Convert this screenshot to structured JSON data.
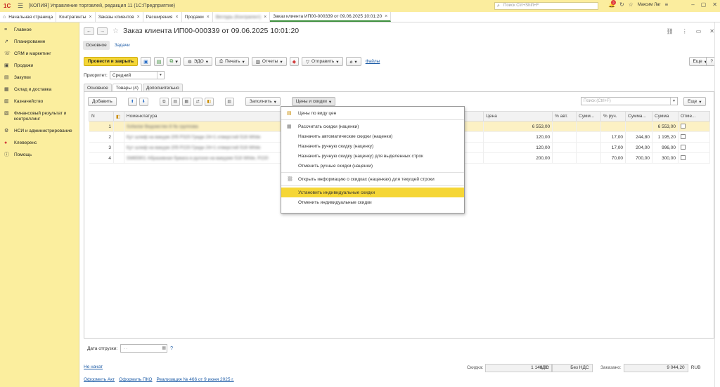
{
  "titlebar": {
    "logo": "1С",
    "title": "[КОПИЯ] Управление торговлей, редакция 11  (1С:Предприятие)",
    "search_placeholder": "Поиск Ctrl+Shift+F",
    "notification_count": "2",
    "user": "Максим Лаг"
  },
  "tabs": [
    {
      "label": "Начальная страница"
    },
    {
      "label": "Контрагенты"
    },
    {
      "label": "Заказы клиентов"
    },
    {
      "label": "Расширения"
    },
    {
      "label": "Продажи"
    },
    {
      "label": "Ветлурь (Контрагент)"
    },
    {
      "label": "Заказ клиента ИП00-000339 от 09.06.2025 10:01:20"
    }
  ],
  "sidebar": {
    "items": [
      {
        "label": "Главное",
        "icon": "menu-icon"
      },
      {
        "label": "Планирование",
        "icon": "chart-icon"
      },
      {
        "label": "CRM и маркетинг",
        "icon": "crm-icon"
      },
      {
        "label": "Продажи",
        "icon": "bag-icon"
      },
      {
        "label": "Закупки",
        "icon": "cart-icon"
      },
      {
        "label": "Склад и доставка",
        "icon": "warehouse-icon"
      },
      {
        "label": "Казначейство",
        "icon": "treasury-icon"
      },
      {
        "label": "Финансовый результат и контроллинг",
        "icon": "finance-icon"
      },
      {
        "label": "НСИ и администрирование",
        "icon": "settings-icon"
      },
      {
        "label": "Клеверенс",
        "icon": "cleverence-icon"
      },
      {
        "label": "Помощь",
        "icon": "help-icon"
      }
    ]
  },
  "doc": {
    "title": "Заказ клиента ИП00-000339 от 09.06.2025 10:01:20",
    "subtab_main": "Основное",
    "subtab_tasks": "Задачи"
  },
  "toolbar": {
    "post_close": "Провести и закрыть",
    "edo": "ЭДО",
    "print": "Печать",
    "reports": "Отчеты",
    "send": "Отправить",
    "files": "Файлы",
    "more": "Еще",
    "help": "?"
  },
  "priority": {
    "label": "Приоритет:",
    "value": "Средний"
  },
  "inner_tabs": [
    "Основное",
    "Товары (4)",
    "Дополнительно"
  ],
  "goods": {
    "add": "Добавить",
    "fill": "Заполнить",
    "prices_discounts": "Цены и скидки",
    "search_placeholder": "Поиск (Ctrl+F)",
    "more": "Еще",
    "columns": [
      "N",
      "",
      "Номенклатура",
      "Цена",
      "% авт.",
      "Сумм...",
      "% руч.",
      "Сумма...",
      "Сумма",
      "Отме..."
    ],
    "rows": [
      {
        "n": "1",
        "name": "Sofastar Ведомство 8 № группова",
        "price": "6 553,00",
        "auto": "",
        "sumauto": "",
        "manual": "",
        "summanual": "",
        "sum": "6 553,00"
      },
      {
        "n": "2",
        "name": "Кут шлиф на вакуум 205 Р320 Гриди 24×1 отверстий 516 White",
        "price": "120,00",
        "auto": "",
        "sumauto": "",
        "manual": "17,00",
        "summanual": "244,80",
        "sum": "1 195,20"
      },
      {
        "n": "3",
        "name": "Кут шлиф на вакуум 205 Р220 Гриди 24×1 отверстий 516 White",
        "price": "120,00",
        "auto": "",
        "sumauto": "",
        "manual": "17,00",
        "summanual": "204,00",
        "sum": "996,00"
      },
      {
        "n": "4",
        "name": "SM65901 Абразивная бумага в рулоне на вакууме 516 White, Р220",
        "price": "200,00",
        "auto": "",
        "sumauto": "",
        "manual": "70,00",
        "summanual": "700,00",
        "sum": "300,00"
      }
    ]
  },
  "menu": {
    "items": [
      {
        "label": "Цены по виду цен",
        "icon": "price-list-icon"
      },
      {
        "sep": true
      },
      {
        "label": "Рассчитать скидки (наценки)",
        "icon": "calc-icon"
      },
      {
        "label": "Назначить автоматические скидки (наценки)",
        "icon": ""
      },
      {
        "label": "Назначить ручную скидку (наценку)",
        "icon": ""
      },
      {
        "label": "Назначить ручную скидку (наценку) для выделенных строк",
        "icon": ""
      },
      {
        "label": "Отменить ручные скидки (наценки)",
        "icon": ""
      },
      {
        "sep": true
      },
      {
        "label": "Открыть информацию о скидках (наценках) для текущей строки",
        "icon": "link-icon"
      },
      {
        "sep": true
      },
      {
        "label": "Установить индивидуальные скидки",
        "icon": "",
        "highlighted": true
      },
      {
        "label": "Отменить индивидуальные скидки",
        "icon": ""
      }
    ]
  },
  "shipment": {
    "label": "Дата отгрузки:",
    "value": ". .",
    "help": "?"
  },
  "status": {
    "state": "Не начат",
    "discount_label": "Скидка:",
    "discount": "1 148,80",
    "vat_label": "НДС:",
    "vat": "Без НДС",
    "ordered_label": "Заказано:",
    "ordered": "9 044,20",
    "currency": "RUB"
  },
  "footer_links": [
    "Оформить Акт",
    "Оформить ПКО",
    "Реализация № 466 от 9 июня 2025 г."
  ],
  "colors": {
    "accent": "#f5d636",
    "sidebar": "#fbee9e",
    "link": "#1c5ba6",
    "active_tab": "#3c8f3c"
  }
}
